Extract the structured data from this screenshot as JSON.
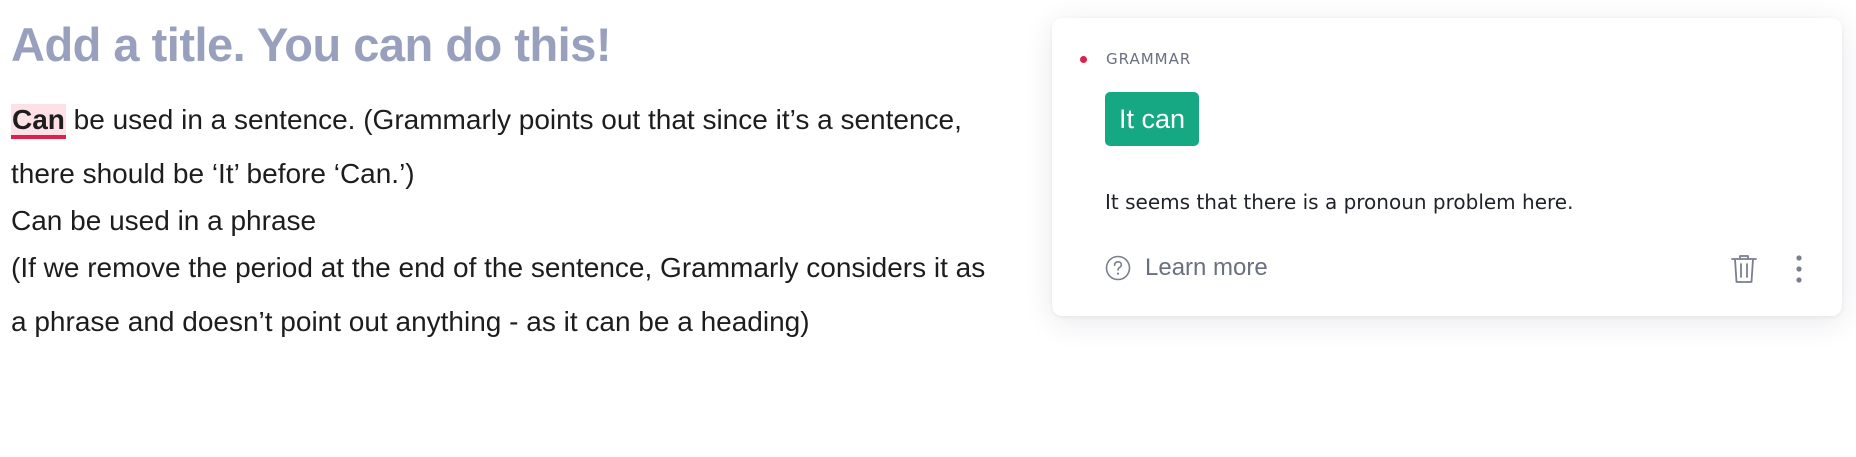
{
  "editor": {
    "title": "Add a title. You can do this!",
    "paragraphs": [
      {
        "flagged_word": "Can",
        "rest": " be used in a sentence. (Grammarly points out that since it’s a sentence, there should be ‘It’ before ‘Can.’)"
      },
      {
        "text": "Can be used in a phrase"
      },
      {
        "text": "(If we remove the period at the end of the sentence, Grammarly considers it as a phrase and doesn’t point out anything - as it can be a heading)"
      }
    ]
  },
  "card": {
    "category": "GRAMMAR",
    "suggestion": "It can",
    "explanation": "It seems that there is a pronoun problem here.",
    "learn_more": "Learn more",
    "icons": {
      "category_dot": "red-dot-icon",
      "help": "question-circle-icon",
      "delete": "trash-icon",
      "more": "more-vertical-icon"
    },
    "colors": {
      "accent_green": "#15a882",
      "alert_red": "#e01e4d",
      "title_gray": "#98a0bd"
    }
  }
}
